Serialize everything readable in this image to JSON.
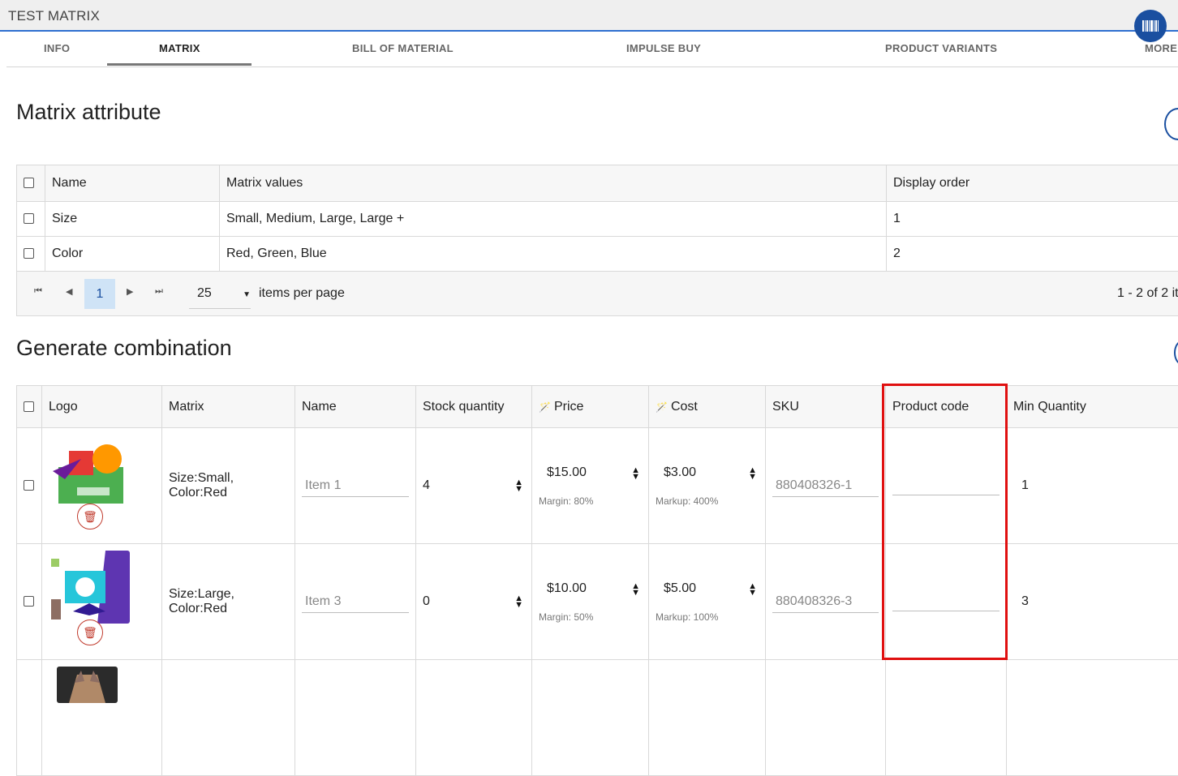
{
  "window": {
    "title": "TEST MATRIX"
  },
  "tabs": [
    {
      "label": "INFO"
    },
    {
      "label": "MATRIX"
    },
    {
      "label": "BILL OF MATERIAL"
    },
    {
      "label": "IMPULSE BUY"
    },
    {
      "label": "PRODUCT VARIANTS"
    },
    {
      "label": "MORE"
    }
  ],
  "matrix_attribute": {
    "title": "Matrix attribute",
    "headers": {
      "name": "Name",
      "values": "Matrix values",
      "order": "Display order"
    },
    "rows": [
      {
        "name": "Size",
        "values": "Small, Medium, Large, Large +",
        "order": "1"
      },
      {
        "name": "Color",
        "values": "Red, Green, Blue",
        "order": "2"
      }
    ],
    "pager": {
      "current_page": "1",
      "page_size": "25",
      "items_per_page_label": "items per page",
      "info": "1 - 2 of 2 it"
    }
  },
  "generate_combination": {
    "title": "Generate combination",
    "headers": {
      "logo": "Logo",
      "matrix": "Matrix",
      "name": "Name",
      "stock": "Stock quantity",
      "price": "Price",
      "cost": "Cost",
      "sku": "SKU",
      "product_code": "Product code",
      "min_qty": "Min Quantity"
    },
    "rows": [
      {
        "matrix": "Size:Small, Color:Red",
        "name_placeholder": "Item 1",
        "stock": "4",
        "price": "$15.00",
        "margin": "Margin: 80%",
        "cost": "$3.00",
        "markup": "Markup: 400%",
        "sku": "880408326-1",
        "product_code": "",
        "min_qty": "1"
      },
      {
        "matrix": "Size:Large, Color:Red",
        "name_placeholder": "Item 3",
        "stock": "0",
        "price": "$10.00",
        "margin": "Margin: 50%",
        "cost": "$5.00",
        "markup": "Markup: 100%",
        "sku": "880408326-3",
        "product_code": "",
        "min_qty": "3"
      }
    ]
  },
  "colors": {
    "accent": "#1a4fa0",
    "highlight": "#e01010",
    "delete": "#c0392b"
  }
}
